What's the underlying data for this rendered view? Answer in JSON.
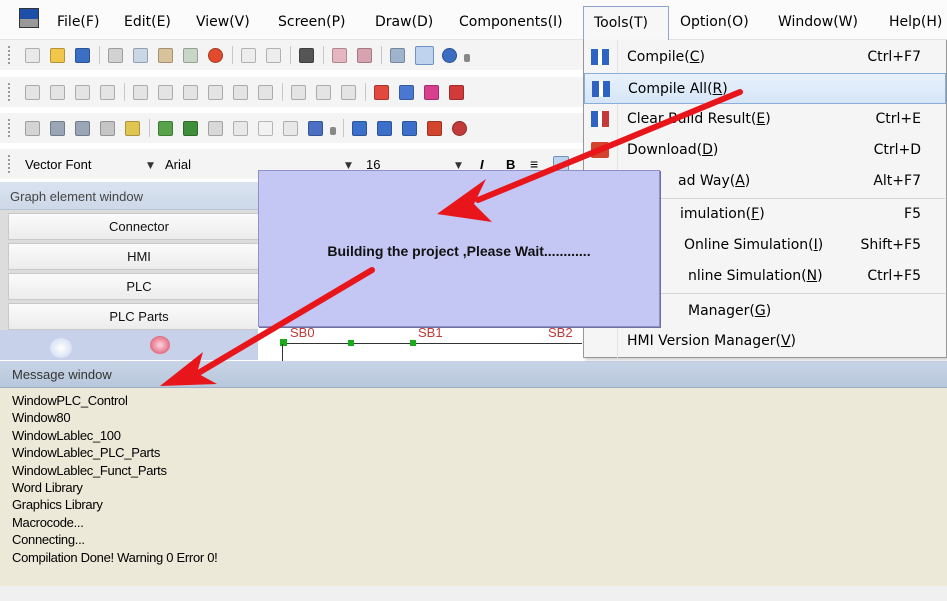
{
  "menubar": {
    "items": [
      "File(F)",
      "Edit(E)",
      "View(V)",
      "Screen(P)",
      "Draw(D)",
      "Components(I)",
      "Tools(T)",
      "Option(O)",
      "Window(W)",
      "Help(H)"
    ]
  },
  "toolbars": {
    "font_name_combo": "Vector Font",
    "font_face_combo": "Arial",
    "font_size_combo": "16",
    "italic_label": "I",
    "bold_label": "B"
  },
  "graph_window": {
    "title": "Graph element window",
    "buttons": [
      "Connector",
      "HMI",
      "PLC",
      "PLC Parts"
    ]
  },
  "tools_menu": {
    "items": [
      {
        "label_pre": "Compile(",
        "key": "C",
        "label_post": ")",
        "shortcut": "Ctrl+F7",
        "icon": "compile-icon"
      },
      {
        "label_pre": "Compile All(",
        "key": "R",
        "label_post": ")",
        "shortcut": "",
        "icon": "compile-all-icon",
        "highlighted": true
      },
      {
        "label_pre": "Clear Build Result(",
        "key": "E",
        "label_post": ")",
        "shortcut": "Ctrl+E",
        "icon": "clear-build-icon"
      },
      {
        "label_pre": "Download(",
        "key": "D",
        "label_post": ")",
        "shortcut": "Ctrl+D",
        "icon": "download-icon"
      },
      {
        "label_pre": "ad Way(",
        "key": "A",
        "label_post": ")",
        "shortcut": "Alt+F7",
        "icon": ""
      },
      {
        "label_pre": "imulation(",
        "key": "F",
        "label_post": ")",
        "shortcut": "F5",
        "icon": ""
      },
      {
        "label_pre": "Online Simulation(",
        "key": "I",
        "label_post": ")",
        "shortcut": "Shift+F5",
        "icon": ""
      },
      {
        "label_pre": "nline Simulation(",
        "key": "N",
        "label_post": ")",
        "shortcut": "Ctrl+F5",
        "icon": ""
      },
      {
        "label_pre": "Manager(",
        "key": "G",
        "label_post": ")",
        "shortcut": "",
        "icon": ""
      },
      {
        "label_pre": "HMI Version Manager(",
        "key": "V",
        "label_post": ")",
        "shortcut": "",
        "icon": ""
      }
    ]
  },
  "build_dialog": {
    "message": "Building the project ,Please Wait............"
  },
  "canvas_labels": [
    "SB0",
    "SB1",
    "SB2"
  ],
  "message_window": {
    "title": "Message window",
    "lines": [
      "WindowPLC_Control",
      "Window80",
      "WindowLablec_100",
      "WindowLablec_PLC_Parts",
      "WindowLablec_Funct_Parts",
      "Word Library",
      "Graphics Library",
      "Macrocode...",
      "Connecting...",
      "Compilation Done! Warning 0 Error 0!"
    ]
  },
  "colors": {
    "dialog_bg": "#c4c6f4",
    "message_bg": "#ece9d8",
    "arrow": "#e8151b",
    "highlight": "#d6e6f7"
  }
}
